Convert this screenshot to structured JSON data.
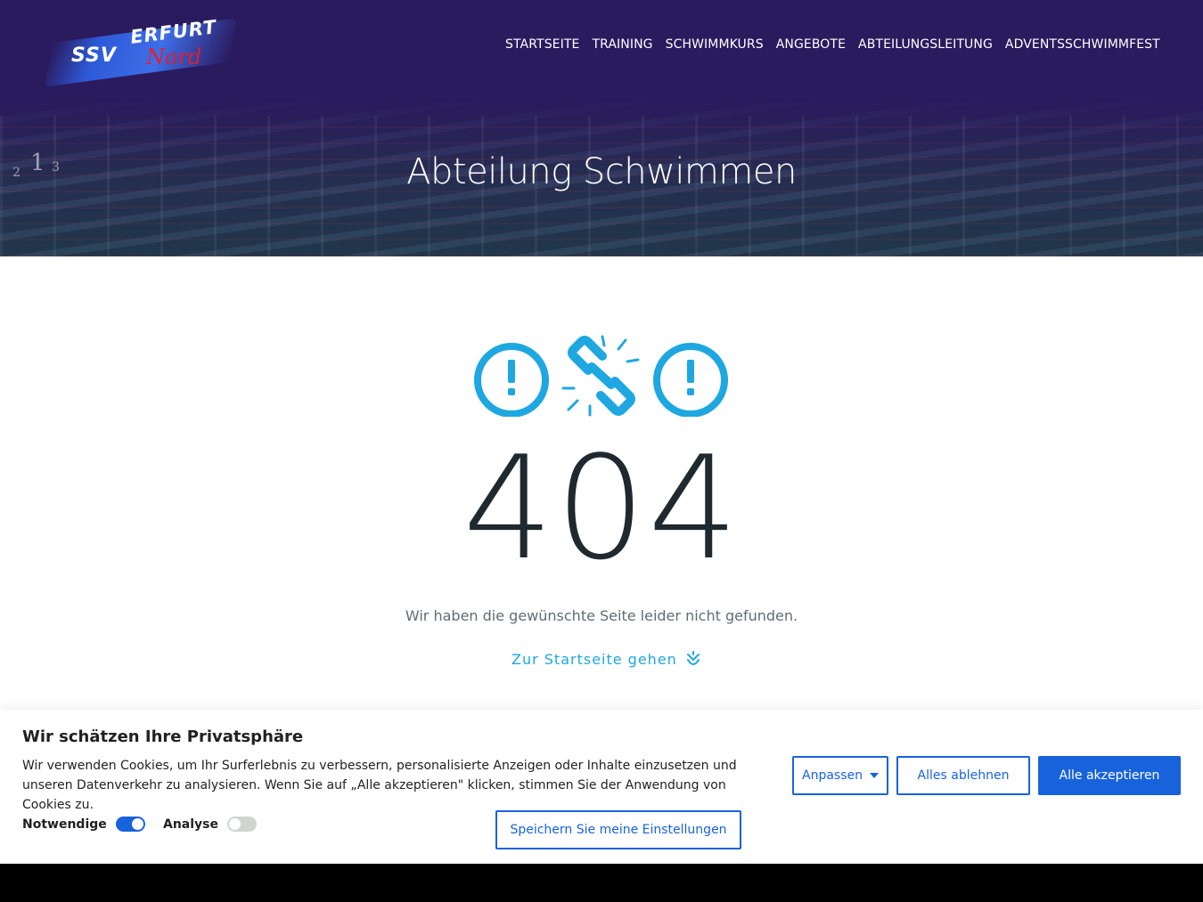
{
  "header": {
    "logo": {
      "ssv": "SSV",
      "erfurt": "ERFURT",
      "nord": "Nord"
    },
    "nav": [
      {
        "label": "STARTSEITE"
      },
      {
        "label": "TRAINING"
      },
      {
        "label": "SCHWIMMKURS"
      },
      {
        "label": "ANGEBOTE"
      },
      {
        "label": "ABTEILUNGSLEITUNG"
      },
      {
        "label": "ADVENTSSCHWIMMFEST"
      }
    ],
    "hero_title": "Abteilung Schwimmen"
  },
  "error": {
    "icons": [
      "exclamation-circle-icon",
      "broken-link-icon",
      "exclamation-circle-icon"
    ],
    "code": "404",
    "message": "Wir haben die gewünschte Seite leider nicht gefunden.",
    "home_link": "Zur Startseite gehen",
    "accent_color": "#1ea7e1"
  },
  "cookie": {
    "title": "Wir schätzen Ihre Privatsphäre",
    "text": "Wir verwenden Cookies, um Ihr Surferlebnis zu verbessern, personalisierte Anzeigen oder Inhalte einzusetzen und unseren Datenverkehr zu analysieren. Wenn Sie auf „Alle akzeptieren\" klicken, stimmen Sie der Anwendung von Cookies zu.",
    "toggles": [
      {
        "label": "Notwendige",
        "on": true
      },
      {
        "label": "Analyse",
        "on": false
      }
    ],
    "buttons": {
      "customize": "Anpassen",
      "reject": "Alles ablehnen",
      "accept": "Alle akzeptieren",
      "save": "Speichern Sie meine Einstellungen"
    },
    "brand_color": "#1863dc"
  }
}
